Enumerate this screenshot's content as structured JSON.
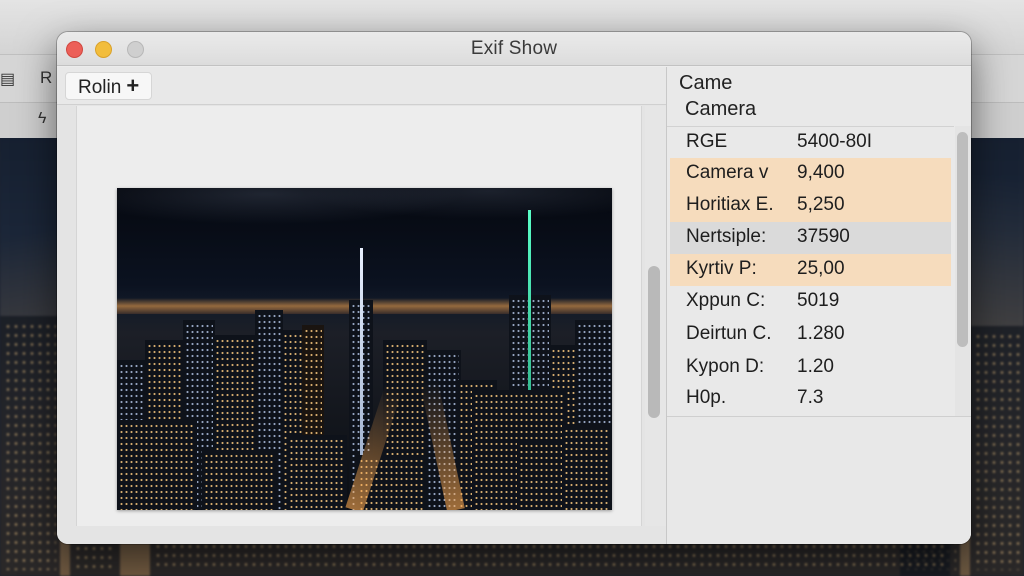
{
  "window": {
    "title": "Exif Show"
  },
  "toolbar": {
    "tab_label": "Rolin",
    "add_symbol": "+"
  },
  "background": {
    "menu_fragment": "R"
  },
  "inspector": {
    "header_1": "Came",
    "header_2": "Camera",
    "rows": [
      {
        "key": "RGE",
        "value": "5400-80I",
        "highlight": "none"
      },
      {
        "key": "Camera v",
        "value": "9,400",
        "highlight": "orange"
      },
      {
        "key": "Horitiax E.",
        "value": "5,250",
        "highlight": "orange"
      },
      {
        "key": "Nertsiple:",
        "value": "37590",
        "highlight": "gray"
      },
      {
        "key": "Kyrtiv P:",
        "value": "25,00",
        "highlight": "orange"
      },
      {
        "key": "Xppun C:",
        "value": "5019",
        "highlight": "none"
      },
      {
        "key": "Deirtun C.",
        "value": "1.280",
        "highlight": "none"
      },
      {
        "key": "Kypon D:",
        "value": "1.20",
        "highlight": "none"
      },
      {
        "key": "H0p.",
        "value": "7.3",
        "highlight": "none"
      }
    ]
  },
  "colors": {
    "highlight_orange": "#f6dcbd",
    "highlight_gray": "#dadada",
    "close": "#ec5f58",
    "minimize": "#f2bd3c"
  },
  "image": {
    "subject": "night city skyline"
  }
}
